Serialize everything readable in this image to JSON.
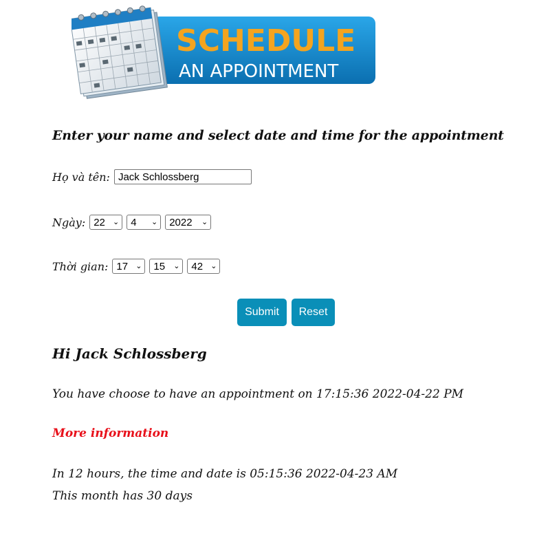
{
  "banner": {
    "line1": "SCHEDULE",
    "line2": "AN APPOINTMENT",
    "bg_color": "#1a86c8",
    "line1_color": "#f4a41f",
    "line2_color": "#ffffff"
  },
  "form": {
    "heading": "Enter your name and select date and time for the appointment",
    "name_label": "Họ và tên:",
    "name_value": "Jack Schlossberg",
    "date_label": "Ngày:",
    "date": {
      "day": "22",
      "month": "4",
      "year": "2022"
    },
    "time_label": "Thời gian:",
    "time": {
      "hour": "17",
      "minute": "15",
      "second": "42"
    },
    "submit_label": "Submit",
    "reset_label": "Reset",
    "button_color": "#0a8fb8"
  },
  "result": {
    "greeting": "Hi Jack Schlossberg",
    "appointment_text": "You have choose to have an appointment on 17:15:36 2022-04-22 PM",
    "more_info": "More information",
    "more_info_color": "#e8101a",
    "in_12_hours_text": "In 12 hours, the time and date is 05:15:36 2022-04-23 AM",
    "month_days_text": "This month has 30 days"
  }
}
